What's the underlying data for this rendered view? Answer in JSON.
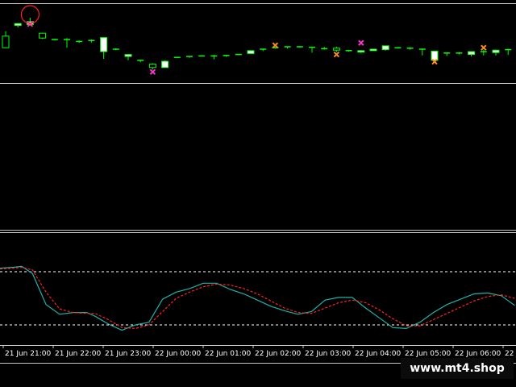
{
  "colors": {
    "background": "#000000",
    "bull_candle": "#ffffff",
    "bear_candle": "#000000",
    "candle_wick": "#00ff00",
    "separator": "#c8c8c8",
    "stoch_main": "#20b2aa",
    "stoch_signal": "#ff2020",
    "stoch_level": "#ffffff",
    "arrow_magenta": "#ff33cc",
    "arrow_orange": "#ff8c1a",
    "highlight_circle": "#ff2020"
  },
  "watermark": "www.mt4.shop",
  "chart_data": [
    {
      "type": "candlestick",
      "title": "",
      "price_range": [
        0,
        100
      ],
      "candles": [
        {
          "o": 62,
          "h": 72,
          "l": 40,
          "c": 38
        },
        {
          "o": 84,
          "h": 88,
          "l": 80,
          "c": 88
        },
        {
          "o": 86,
          "h": 100,
          "l": 84,
          "c": 92
        },
        {
          "o": 68,
          "h": 69,
          "l": 56,
          "c": 58
        },
        {
          "o": 55,
          "h": 56,
          "l": 53,
          "c": 55
        },
        {
          "o": 54,
          "h": 58,
          "l": 38,
          "c": 55
        },
        {
          "o": 51,
          "h": 53,
          "l": 48,
          "c": 51
        },
        {
          "o": 51,
          "h": 55,
          "l": 49,
          "c": 53
        },
        {
          "o": 30,
          "h": 59,
          "l": 15,
          "c": 59
        },
        {
          "o": 35,
          "h": 37,
          "l": 33,
          "c": 35
        },
        {
          "o": 20,
          "h": 24,
          "l": 12,
          "c": 24
        },
        {
          "o": 11,
          "h": 12,
          "l": 8,
          "c": 12
        },
        {
          "o": 4,
          "h": 6,
          "l": -7,
          "c": -3
        },
        {
          "o": -3,
          "h": 12,
          "l": -3,
          "c": 10
        },
        {
          "o": 18,
          "h": 19,
          "l": 17,
          "c": 18
        },
        {
          "o": 18,
          "h": 20,
          "l": 17,
          "c": 20
        },
        {
          "o": 21,
          "h": 22,
          "l": 20,
          "c": 21
        },
        {
          "o": 21,
          "h": 23,
          "l": 14,
          "c": 20
        },
        {
          "o": 20,
          "h": 23,
          "l": 19,
          "c": 22
        },
        {
          "o": 24,
          "h": 25,
          "l": 23,
          "c": 24
        },
        {
          "o": 26,
          "h": 32,
          "l": 25,
          "c": 32
        },
        {
          "o": 35,
          "h": 36,
          "l": 31,
          "c": 35
        },
        {
          "o": 38,
          "h": 38,
          "l": 36,
          "c": 38
        },
        {
          "o": 38,
          "h": 40,
          "l": 36,
          "c": 40
        },
        {
          "o": 40,
          "h": 40,
          "l": 38,
          "c": 40
        },
        {
          "o": 39,
          "h": 40,
          "l": 28,
          "c": 38
        },
        {
          "o": 36,
          "h": 40,
          "l": 34,
          "c": 36
        },
        {
          "o": 37,
          "h": 40,
          "l": 29,
          "c": 33
        },
        {
          "o": 32,
          "h": 33,
          "l": 30,
          "c": 32
        },
        {
          "o": 29,
          "h": 33,
          "l": 27,
          "c": 32
        },
        {
          "o": 32,
          "h": 35,
          "l": 32,
          "c": 35
        },
        {
          "o": 34,
          "h": 42,
          "l": 32,
          "c": 42
        },
        {
          "o": 38,
          "h": 39,
          "l": 36,
          "c": 38
        },
        {
          "o": 37,
          "h": 39,
          "l": 34,
          "c": 37
        },
        {
          "o": 35,
          "h": 36,
          "l": 22,
          "c": 35
        },
        {
          "o": 12,
          "h": 31,
          "l": 12,
          "c": 31
        },
        {
          "o": 27,
          "h": 28,
          "l": 21,
          "c": 27
        },
        {
          "o": 27,
          "h": 29,
          "l": 24,
          "c": 27
        },
        {
          "o": 24,
          "h": 30,
          "l": 20,
          "c": 30
        },
        {
          "o": 30,
          "h": 33,
          "l": 22,
          "c": 30
        },
        {
          "o": 28,
          "h": 34,
          "l": 22,
          "c": 33
        },
        {
          "o": 33,
          "h": 36,
          "l": 23,
          "c": 34
        },
        {
          "o": 30,
          "h": 33,
          "l": 25,
          "c": 30
        }
      ],
      "arrows": [
        {
          "bar": 2,
          "price": 87,
          "kind": "magenta"
        },
        {
          "bar": 12,
          "price": -12,
          "kind": "magenta"
        },
        {
          "bar": 22,
          "price": 43,
          "kind": "orange"
        },
        {
          "bar": 27,
          "price": 24,
          "kind": "orange"
        },
        {
          "bar": 29,
          "price": 48,
          "kind": "magenta"
        },
        {
          "bar": 35,
          "price": 9,
          "kind": "orange"
        },
        {
          "bar": 39,
          "price": 38,
          "kind": "orange"
        }
      ],
      "highlight_bar": 2
    },
    {
      "type": "line",
      "title": "",
      "ylim": [
        0,
        100
      ],
      "levels": [
        80,
        20
      ],
      "x": [
        "21 Jun 21:00",
        "21 Jun 22:00",
        "21 Jun 23:00",
        "22 Jun 00:00",
        "22 Jun 01:00",
        "22 Jun 02:00",
        "22 Jun 03:00",
        "22 Jun 04:00",
        "22 Jun 05:00",
        "22 Jun 06:00",
        "22 Jun 0"
      ],
      "series": [
        {
          "key": "main",
          "values": [
            [
              0,
              84
            ],
            [
              1,
              85
            ],
            [
              1.6,
              86
            ],
            [
              2.4,
              78
            ],
            [
              3.4,
              43
            ],
            [
              4.4,
              32
            ],
            [
              5.4,
              34
            ],
            [
              6.4,
              34
            ],
            [
              7,
              30
            ],
            [
              8,
              21
            ],
            [
              9,
              14
            ],
            [
              10,
              20
            ],
            [
              11,
              23
            ],
            [
              12,
              49
            ],
            [
              13,
              57
            ],
            [
              14,
              61
            ],
            [
              15,
              67
            ],
            [
              16,
              67
            ],
            [
              17,
              60
            ],
            [
              18,
              55
            ],
            [
              19,
              48
            ],
            [
              20,
              41
            ],
            [
              21,
              36
            ],
            [
              22,
              32
            ],
            [
              23,
              35
            ],
            [
              24,
              48
            ],
            [
              25,
              51
            ],
            [
              26,
              51
            ],
            [
              27,
              39
            ],
            [
              28,
              28
            ],
            [
              29,
              17
            ],
            [
              30,
              16
            ],
            [
              31,
              23
            ],
            [
              32,
              34
            ],
            [
              33,
              43
            ],
            [
              34,
              49
            ],
            [
              35,
              55
            ],
            [
              36,
              56
            ],
            [
              37,
              53
            ],
            [
              38,
              42
            ]
          ]
        },
        {
          "key": "signal",
          "values": [
            [
              0,
              83
            ],
            [
              1,
              84
            ],
            [
              1.6,
              85
            ],
            [
              2.4,
              82
            ],
            [
              3.4,
              57
            ],
            [
              4.4,
              38
            ],
            [
              5.4,
              34
            ],
            [
              6.4,
              33
            ],
            [
              7,
              33
            ],
            [
              8,
              26
            ],
            [
              9,
              17
            ],
            [
              10,
              16
            ],
            [
              11,
              20
            ],
            [
              12,
              35
            ],
            [
              13,
              50
            ],
            [
              14,
              57
            ],
            [
              15,
              63
            ],
            [
              16,
              66
            ],
            [
              17,
              65
            ],
            [
              18,
              61
            ],
            [
              19,
              55
            ],
            [
              20,
              47
            ],
            [
              21,
              39
            ],
            [
              22,
              34
            ],
            [
              23,
              33
            ],
            [
              24,
              39
            ],
            [
              25,
              45
            ],
            [
              26,
              48
            ],
            [
              27,
              45
            ],
            [
              28,
              37
            ],
            [
              29,
              27
            ],
            [
              30,
              19
            ],
            [
              31,
              19
            ],
            [
              32,
              26
            ],
            [
              33,
              33
            ],
            [
              34,
              40
            ],
            [
              35,
              47
            ],
            [
              36,
              52
            ],
            [
              37,
              54
            ],
            [
              38,
              50
            ]
          ]
        }
      ]
    }
  ]
}
